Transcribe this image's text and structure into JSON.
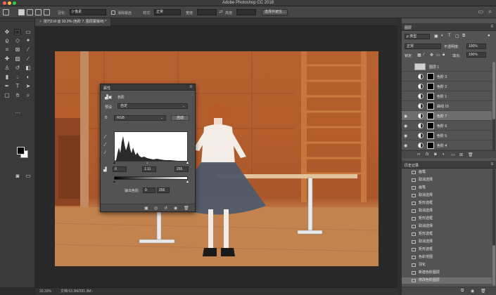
{
  "window": {
    "title": "Adobe Photoshop CC 2018"
  },
  "options": {
    "feather_label": "羽化:",
    "feather_value": "0 像素",
    "antialias_label": "消除锯齿",
    "style_label": "样式:",
    "style_value": "正常",
    "width_label": "宽度:",
    "height_label": "高度:",
    "select_mask_button": "选择并遮住..."
  },
  "document": {
    "tab_label": "技巧2.tif @ 33.3% (色阶 7, 图层蒙版/8) *",
    "zoom": "33.33%",
    "doc_info": "文档:63.3M/281.3M"
  },
  "properties": {
    "title": "属性",
    "layer_type": "色阶",
    "preset_label": "预设:",
    "preset_value": "自定",
    "channel_value": "RGB",
    "auto_button": "自动",
    "input_black": "0",
    "input_gamma": "1.11",
    "input_white": "255",
    "output_label": "输出色阶:",
    "output_black": "0",
    "output_white": "255"
  },
  "layers_panel": {
    "title": "图层",
    "filter_value": "ρ 类型",
    "blend_mode": "正常",
    "opacity_label": "不透明度:",
    "opacity_value": "100%",
    "lock_label": "锁定:",
    "fill_label": "填充:",
    "fill_value": "100%",
    "layers": [
      {
        "name": "图层 1",
        "kind": "group",
        "mask": "light"
      },
      {
        "name": "色阶 3",
        "kind": "adj",
        "mask": "dark"
      },
      {
        "name": "色阶 2",
        "kind": "adj",
        "mask": "dark"
      },
      {
        "name": "色阶 1",
        "kind": "adj",
        "mask": "dark"
      },
      {
        "name": "曲线 15",
        "kind": "adj",
        "mask": "dark"
      },
      {
        "name": "色阶 7",
        "kind": "adj",
        "mask": "dark",
        "selected": true
      },
      {
        "name": "色阶 6",
        "kind": "adj",
        "mask": "dark"
      },
      {
        "name": "色阶 5",
        "kind": "adj",
        "mask": "dark"
      },
      {
        "name": "色阶 4",
        "kind": "adj",
        "mask": "dark"
      }
    ]
  },
  "history_panel": {
    "title": "历史记录",
    "items": [
      "画笔",
      "取消选择",
      "画笔",
      "取消选择",
      "矩形选框",
      "取消选择",
      "矩形选框",
      "取消选择",
      "矩形选框",
      "取消选择",
      "矩形选框",
      "色彩范围",
      "羽化",
      "新建色阶图层",
      "修改色阶图层"
    ],
    "active_index": 14
  }
}
